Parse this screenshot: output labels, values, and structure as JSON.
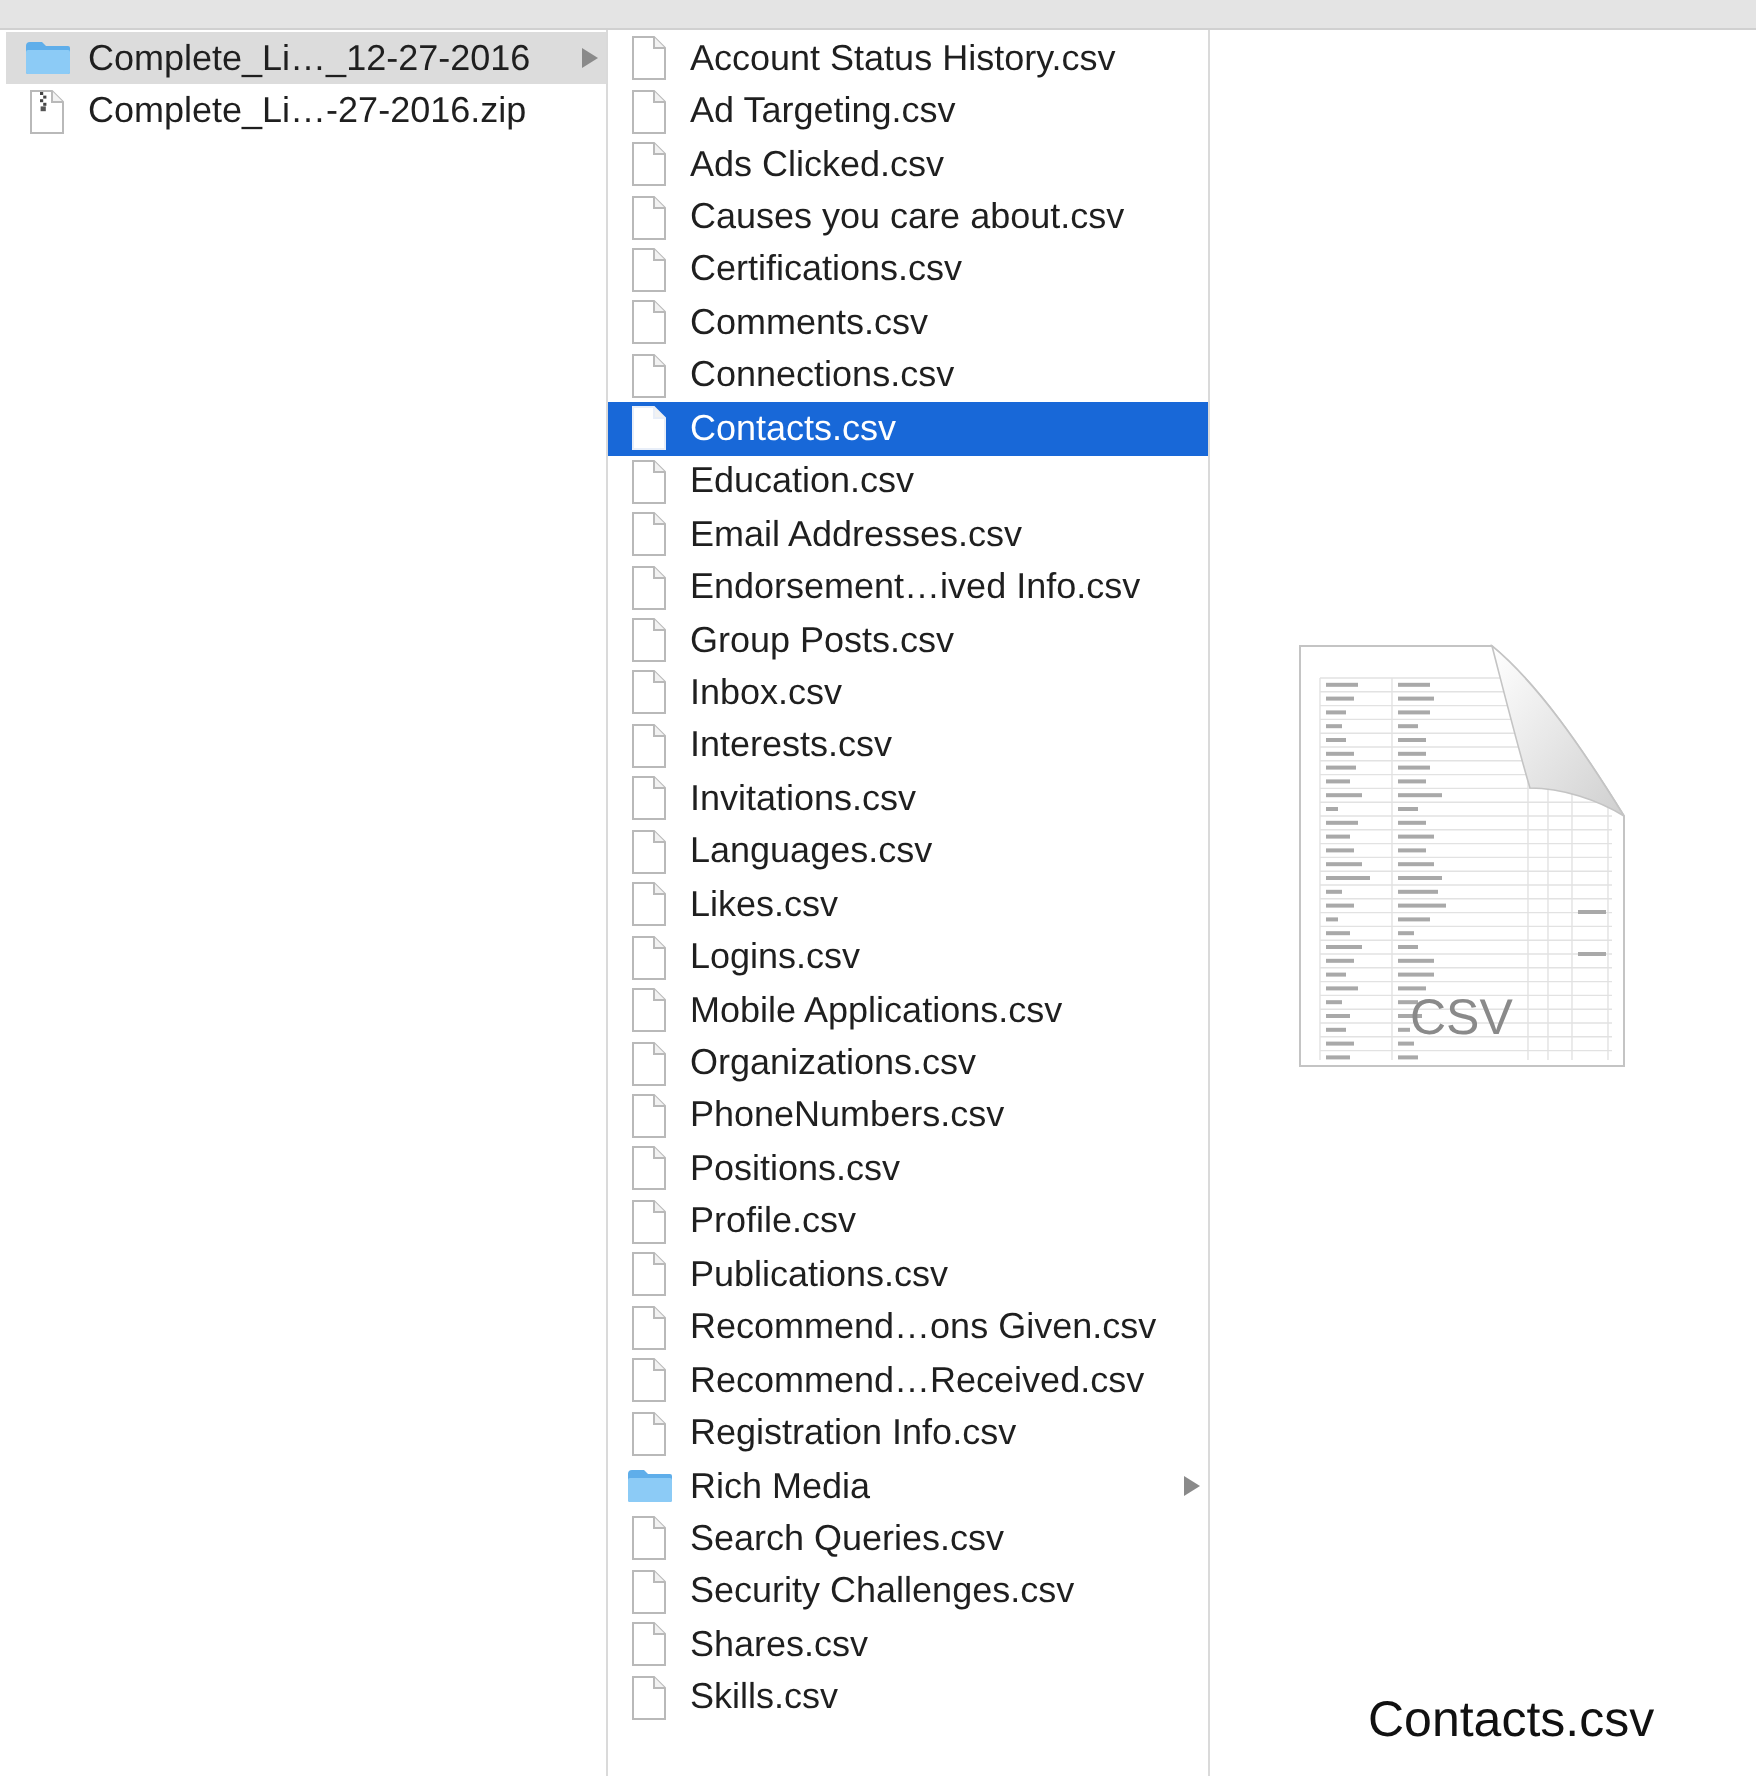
{
  "columns": [
    {
      "active": false,
      "items": [
        {
          "name": "Complete_Li…_12-27-2016",
          "kind": "folder",
          "selected": true
        },
        {
          "name": "Complete_Li…-27-2016.zip",
          "kind": "zip",
          "selected": false
        }
      ]
    },
    {
      "active": true,
      "items": [
        {
          "name": "Account Status History.csv",
          "kind": "file",
          "selected": false
        },
        {
          "name": "Ad Targeting.csv",
          "kind": "file",
          "selected": false
        },
        {
          "name": "Ads Clicked.csv",
          "kind": "file",
          "selected": false
        },
        {
          "name": "Causes you care about.csv",
          "kind": "file",
          "selected": false
        },
        {
          "name": "Certifications.csv",
          "kind": "file",
          "selected": false
        },
        {
          "name": "Comments.csv",
          "kind": "file",
          "selected": false
        },
        {
          "name": "Connections.csv",
          "kind": "file",
          "selected": false
        },
        {
          "name": "Contacts.csv",
          "kind": "file",
          "selected": true
        },
        {
          "name": "Education.csv",
          "kind": "file",
          "selected": false
        },
        {
          "name": "Email Addresses.csv",
          "kind": "file",
          "selected": false
        },
        {
          "name": "Endorsement…ived Info.csv",
          "kind": "file",
          "selected": false
        },
        {
          "name": "Group Posts.csv",
          "kind": "file",
          "selected": false
        },
        {
          "name": "Inbox.csv",
          "kind": "file",
          "selected": false
        },
        {
          "name": "Interests.csv",
          "kind": "file",
          "selected": false
        },
        {
          "name": "Invitations.csv",
          "kind": "file",
          "selected": false
        },
        {
          "name": "Languages.csv",
          "kind": "file",
          "selected": false
        },
        {
          "name": "Likes.csv",
          "kind": "file",
          "selected": false
        },
        {
          "name": "Logins.csv",
          "kind": "file",
          "selected": false
        },
        {
          "name": "Mobile Applications.csv",
          "kind": "file",
          "selected": false
        },
        {
          "name": "Organizations.csv",
          "kind": "file",
          "selected": false
        },
        {
          "name": "PhoneNumbers.csv",
          "kind": "file",
          "selected": false
        },
        {
          "name": "Positions.csv",
          "kind": "file",
          "selected": false
        },
        {
          "name": "Profile.csv",
          "kind": "file",
          "selected": false
        },
        {
          "name": "Publications.csv",
          "kind": "file",
          "selected": false
        },
        {
          "name": "Recommend…ons Given.csv",
          "kind": "file",
          "selected": false
        },
        {
          "name": "Recommend…Received.csv",
          "kind": "file",
          "selected": false
        },
        {
          "name": "Registration Info.csv",
          "kind": "file",
          "selected": false
        },
        {
          "name": "Rich Media",
          "kind": "folder",
          "selected": false
        },
        {
          "name": "Search Queries.csv",
          "kind": "file",
          "selected": false
        },
        {
          "name": "Security Challenges.csv",
          "kind": "file",
          "selected": false
        },
        {
          "name": "Shares.csv",
          "kind": "file",
          "selected": false
        },
        {
          "name": "Skills.csv",
          "kind": "file",
          "selected": false
        }
      ]
    }
  ],
  "preview": {
    "type_label": "CSV",
    "file_name": "Contacts.csv"
  }
}
